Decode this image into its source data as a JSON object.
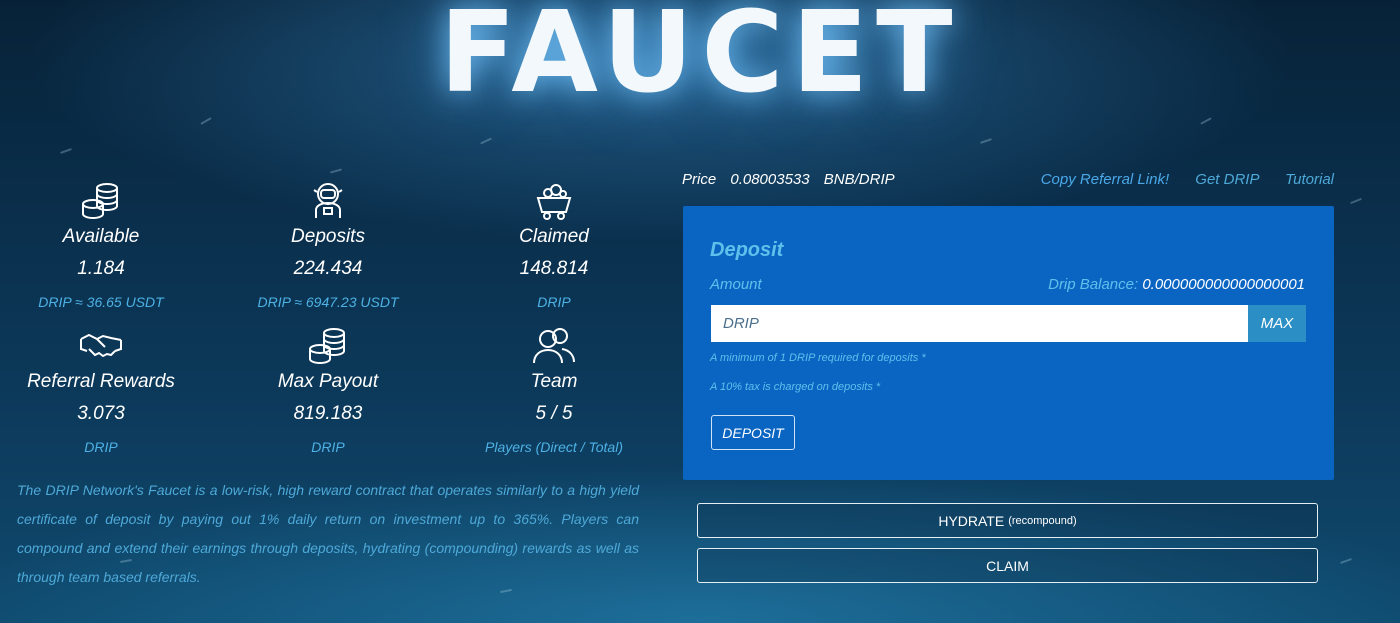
{
  "header": {
    "title": "FAUCET"
  },
  "stats": [
    {
      "icon": "coins-icon",
      "label": "Available",
      "value": "1.184",
      "sub": "DRIP ≈ 36.65 USDT"
    },
    {
      "icon": "astronaut-icon",
      "label": "Deposits",
      "value": "224.434",
      "sub": "DRIP ≈ 6947.23 USDT"
    },
    {
      "icon": "mine-cart-icon",
      "label": "Claimed",
      "value": "148.814",
      "sub": "DRIP"
    },
    {
      "icon": "handshake-icon",
      "label": "Referral Rewards",
      "value": "3.073",
      "sub": "DRIP"
    },
    {
      "icon": "coins-stack-icon",
      "label": "Max Payout",
      "value": "819.183",
      "sub": "DRIP"
    },
    {
      "icon": "team-icon",
      "label": "Team",
      "value": "5 / 5",
      "sub": "Players (Direct / Total)"
    }
  ],
  "description": "The DRIP Network's Faucet is a low-risk, high reward contract that operates similarly to a high yield certificate of deposit by paying out 1% daily return on investment up to 365%. Players can compound and extend their earnings through deposits, hydrating (compounding) rewards as well as through team based referrals.",
  "topbar": {
    "price_label": "Price",
    "price_value": "0.08003533",
    "price_unit": "BNB/DRIP",
    "links": [
      "Copy Referral Link!",
      "Get DRIP",
      "Tutorial"
    ]
  },
  "deposit": {
    "title": "Deposit",
    "amount_label": "Amount",
    "balance_label": "Drip Balance:",
    "balance_value": "0.000000000000000001",
    "input_placeholder": "DRIP",
    "max_label": "MAX",
    "note_min": "A minimum of 1 DRIP required for deposits *",
    "note_tax": "A 10% tax is charged on deposits *",
    "button_label": "DEPOSIT"
  },
  "actions": {
    "hydrate_label": "HYDRATE",
    "hydrate_sub": "(recompound)",
    "claim_label": "CLAIM"
  },
  "colors": {
    "accent": "#4ea9d8",
    "panel": "#0a64c2",
    "background": "#0a2f4c"
  }
}
